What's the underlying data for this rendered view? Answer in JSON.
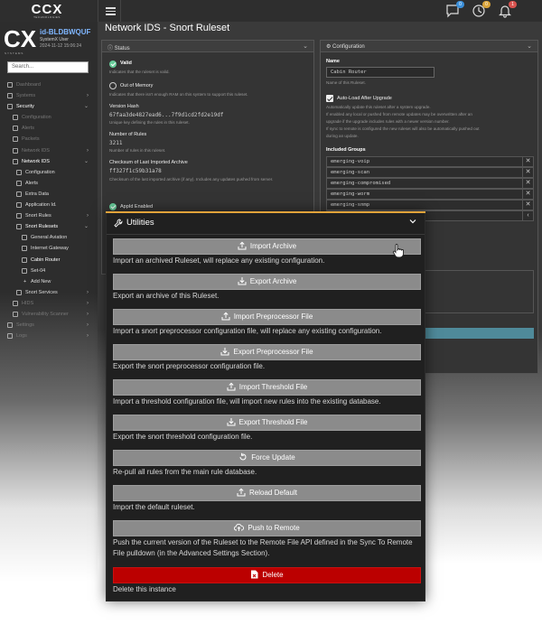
{
  "topbar": {
    "logo": "CCX",
    "logo_sub": "TECHNOLOGIES",
    "badges": {
      "messages": "0",
      "status": "0",
      "alerts": "1"
    },
    "colors": {
      "messages_badge": "#3b8fd9",
      "status_badge": "#d9a43b",
      "alerts_badge": "#d9534f"
    }
  },
  "device": {
    "logo": "CX",
    "logo_sub": "SYSTEMS",
    "id": "id-BLDBWQUF",
    "user": "SystemX User",
    "timestamp": "2024-11-12 15:06:24"
  },
  "sidebar": {
    "search_placeholder": "Search...",
    "items": [
      {
        "label": "Dashboard",
        "icon": "dashboard-icon",
        "has_chevron": false
      },
      {
        "label": "Systems",
        "icon": "systems-icon",
        "has_chevron": true
      },
      {
        "label": "Security",
        "icon": "shield-icon",
        "has_chevron": true
      },
      {
        "label": "Configuration",
        "icon": "gear-icon",
        "has_chevron": false
      },
      {
        "label": "Alerts",
        "icon": "alert-icon",
        "has_chevron": false
      },
      {
        "label": "Packets",
        "icon": "packet-icon",
        "has_chevron": false
      },
      {
        "label": "Network IDS",
        "icon": "network-icon",
        "has_chevron": true
      },
      {
        "label": "Network IDS",
        "icon": "network-icon",
        "has_chevron": true
      },
      {
        "label": "Configuration",
        "icon": "gear-icon",
        "has_chevron": false
      },
      {
        "label": "Alerts",
        "icon": "alert-icon",
        "has_chevron": false
      },
      {
        "label": "Extra Data",
        "icon": "data-icon",
        "has_chevron": false
      },
      {
        "label": "Application Id.",
        "icon": "app-icon",
        "has_chevron": false
      },
      {
        "label": "Snort Rules",
        "icon": "rules-icon",
        "has_chevron": true
      },
      {
        "label": "Snort Rulesets",
        "icon": "rules-icon",
        "has_chevron": true
      },
      {
        "label": "General Aviation",
        "icon": "ruleset-icon",
        "has_chevron": false
      },
      {
        "label": "Internet Gateway",
        "icon": "ruleset-icon",
        "has_chevron": false
      },
      {
        "label": "Cabin Router",
        "icon": "ruleset-icon",
        "has_chevron": false
      },
      {
        "label": "Set-04",
        "icon": "ruleset-icon",
        "has_chevron": false
      },
      {
        "label": "Add New",
        "icon": "plus-icon",
        "has_chevron": false
      },
      {
        "label": "Snort Services",
        "icon": "service-icon",
        "has_chevron": true
      },
      {
        "label": "HIDS",
        "icon": "hids-icon",
        "has_chevron": true
      },
      {
        "label": "Vulnerability Scanner",
        "icon": "scan-icon",
        "has_chevron": true
      },
      {
        "label": "Settings",
        "icon": "settings-icon",
        "has_chevron": true
      },
      {
        "label": "Logs",
        "icon": "logs-icon",
        "has_chevron": true
      }
    ]
  },
  "page": {
    "title": "Network IDS - Snort Ruleset"
  },
  "status_card": {
    "header": "Status",
    "valid_title": "Valid",
    "valid_desc": "Indicates that the ruleset is valid.",
    "oom_title": "Out of Memory",
    "oom_desc": "Indicates that there isn't enough RAM on this system to support this ruleset.",
    "hash_title": "Version Hash",
    "hash_value": "67faa3de4827ead6...7f9d1cd2fd2e19df",
    "hash_desc": "Unique key defining the rules in this ruleset.",
    "rules_title": "Number of Rules",
    "rules_value": "3211",
    "rules_desc": "Number of rules in this ruleset.",
    "checksum_title": "Checksum of Last Imported Archive",
    "checksum_value": "ff327f1c59b31a78",
    "checksum_desc": "Checksum of the last imported archive (if any). Includes any updates pushed from server.",
    "appid_title": "AppId Enabled"
  },
  "config_card": {
    "header": "Configuration",
    "name_label": "Name",
    "name_value": "Cabin Router",
    "name_desc": "Name of this Ruleset.",
    "autoload_label": "Auto-Load After Upgrade",
    "autoload_desc1": "Automatically update this ruleset after a system upgrade.",
    "autoload_desc2": "If enabled any local or pushed from remote updates may be overwritten after an",
    "autoload_desc3": "upgrade if the upgrade includes rules with a newer version number.",
    "autoload_desc4": "If sync to remote is configured the new ruleset will also be automatically pushed out",
    "autoload_desc5": "during an update.",
    "groups_label": "Included Groups",
    "groups": [
      "emerging-voip",
      "emerging-scan",
      "emerging-compromised",
      "emerging-worm",
      "emerging-snmp"
    ]
  },
  "modal": {
    "title": "Utilities",
    "actions": [
      {
        "label": "Import Archive",
        "icon": "upload-icon",
        "desc": "Import an archived Ruleset, will replace any existing configuration."
      },
      {
        "label": "Export Archive",
        "icon": "download-icon",
        "desc": "Export an archive of this Ruleset."
      },
      {
        "label": "Import Preprocessor File",
        "icon": "upload-icon",
        "desc": "Import a snort preprocessor configuration file, will replace any existing configuration."
      },
      {
        "label": "Export Preprocessor File",
        "icon": "download-icon",
        "desc": "Export the snort preprocessor configuration file."
      },
      {
        "label": "Import Threshold File",
        "icon": "upload-icon",
        "desc": "Import a threshold configuration file, will import new rules into the existing database."
      },
      {
        "label": "Export Threshold File",
        "icon": "download-icon",
        "desc": "Export the snort threshold configuration file."
      },
      {
        "label": "Force Update",
        "icon": "refresh-icon",
        "desc": "Re-pull all rules from the main rule database."
      },
      {
        "label": "Reload Default",
        "icon": "upload-icon",
        "desc": "Import the default ruleset."
      },
      {
        "label": "Push to Remote",
        "icon": "cloud-upload-icon",
        "desc": "Push the current version of the Ruleset to the Remote File API defined in the Sync To Remote File pulldown (in the Advanced Settings Section)."
      },
      {
        "label": "Delete",
        "icon": "delete-file-icon",
        "desc": "Delete this instance"
      }
    ],
    "colors": {
      "accent": "#e1a33a",
      "button": "#8b8b8b",
      "danger": "#bb0000"
    }
  }
}
